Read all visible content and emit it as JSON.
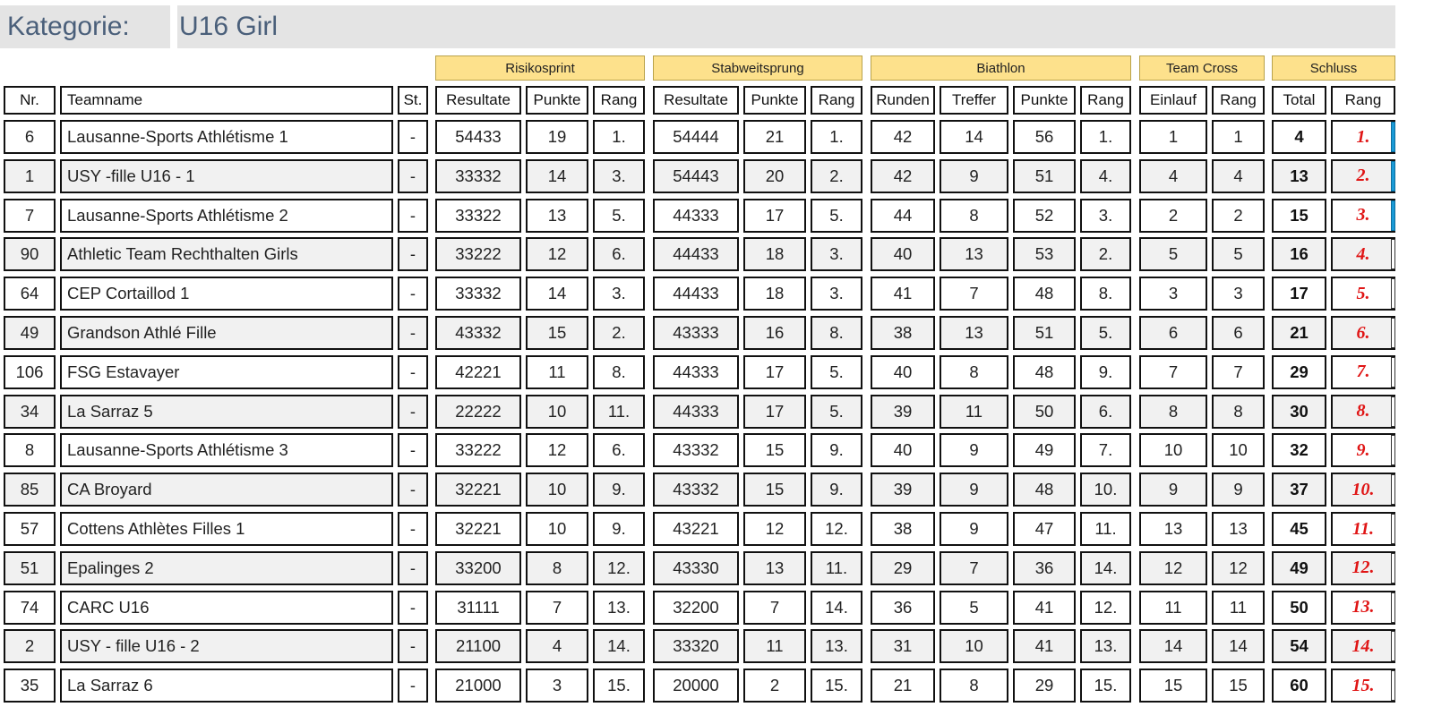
{
  "category": {
    "label": "Kategorie:",
    "value": "U16 Girl"
  },
  "groups": [
    "Risikosprint",
    "Stabweitsprung",
    "Biathlon",
    "Team Cross",
    "Schluss"
  ],
  "columns": [
    "Nr.",
    "Teamname",
    "St.",
    "Resultate",
    "Punkte",
    "Rang",
    "Resultate",
    "Punkte",
    "Rang",
    "Runden",
    "Treffer",
    "Punkte",
    "Rang",
    "Einlauf",
    "Rang",
    "Total",
    "Rang"
  ],
  "rows": [
    [
      "6",
      "Lausanne-Sports Athlétisme 1",
      "-",
      "54433",
      "19",
      "1.",
      "54444",
      "21",
      "1.",
      "42",
      "14",
      "56",
      "1.",
      "1",
      "1",
      "4",
      "1."
    ],
    [
      "1",
      "USY -fille U16 - 1",
      "-",
      "33332",
      "14",
      "3.",
      "54443",
      "20",
      "2.",
      "42",
      "9",
      "51",
      "4.",
      "4",
      "4",
      "13",
      "2."
    ],
    [
      "7",
      "Lausanne-Sports Athlétisme 2",
      "-",
      "33322",
      "13",
      "5.",
      "44333",
      "17",
      "5.",
      "44",
      "8",
      "52",
      "3.",
      "2",
      "2",
      "15",
      "3."
    ],
    [
      "90",
      "Athletic Team Rechthalten Girls",
      "-",
      "33222",
      "12",
      "6.",
      "44433",
      "18",
      "3.",
      "40",
      "13",
      "53",
      "2.",
      "5",
      "5",
      "16",
      "4."
    ],
    [
      "64",
      "CEP Cortaillod 1",
      "-",
      "33332",
      "14",
      "3.",
      "44433",
      "18",
      "3.",
      "41",
      "7",
      "48",
      "8.",
      "3",
      "3",
      "17",
      "5."
    ],
    [
      "49",
      "Grandson Athlé Fille",
      "-",
      "43332",
      "15",
      "2.",
      "43333",
      "16",
      "8.",
      "38",
      "13",
      "51",
      "5.",
      "6",
      "6",
      "21",
      "6."
    ],
    [
      "106",
      "FSG Estavayer",
      "-",
      "42221",
      "11",
      "8.",
      "44333",
      "17",
      "5.",
      "40",
      "8",
      "48",
      "9.",
      "7",
      "7",
      "29",
      "7."
    ],
    [
      "34",
      "La Sarraz 5",
      "-",
      "22222",
      "10",
      "11.",
      "44333",
      "17",
      "5.",
      "39",
      "11",
      "50",
      "6.",
      "8",
      "8",
      "30",
      "8."
    ],
    [
      "8",
      "Lausanne-Sports Athlétisme 3",
      "-",
      "33222",
      "12",
      "6.",
      "43332",
      "15",
      "9.",
      "40",
      "9",
      "49",
      "7.",
      "10",
      "10",
      "32",
      "9."
    ],
    [
      "85",
      "CA Broyard",
      "-",
      "32221",
      "10",
      "9.",
      "43332",
      "15",
      "9.",
      "39",
      "9",
      "48",
      "10.",
      "9",
      "9",
      "37",
      "10."
    ],
    [
      "57",
      "Cottens Athlètes Filles 1",
      "-",
      "32221",
      "10",
      "9.",
      "43221",
      "12",
      "12.",
      "38",
      "9",
      "47",
      "11.",
      "13",
      "13",
      "45",
      "11."
    ],
    [
      "51",
      "Epalinges 2",
      "-",
      "33200",
      "8",
      "12.",
      "43330",
      "13",
      "11.",
      "29",
      "7",
      "36",
      "14.",
      "12",
      "12",
      "49",
      "12."
    ],
    [
      "74",
      "CARC U16",
      "-",
      "31111",
      "7",
      "13.",
      "32200",
      "7",
      "14.",
      "36",
      "5",
      "41",
      "12.",
      "11",
      "11",
      "50",
      "13."
    ],
    [
      "2",
      "USY - fille U16 - 2",
      "-",
      "21100",
      "4",
      "14.",
      "33320",
      "11",
      "13.",
      "31",
      "10",
      "41",
      "13.",
      "14",
      "14",
      "54",
      "14."
    ],
    [
      "35",
      "La Sarraz 6",
      "-",
      "21000",
      "3",
      "15.",
      "20000",
      "2",
      "15.",
      "21",
      "8",
      "29",
      "15.",
      "15",
      "15",
      "60",
      "15."
    ]
  ],
  "podium_marker_color": "#1a9ad6",
  "podium_count": 3
}
